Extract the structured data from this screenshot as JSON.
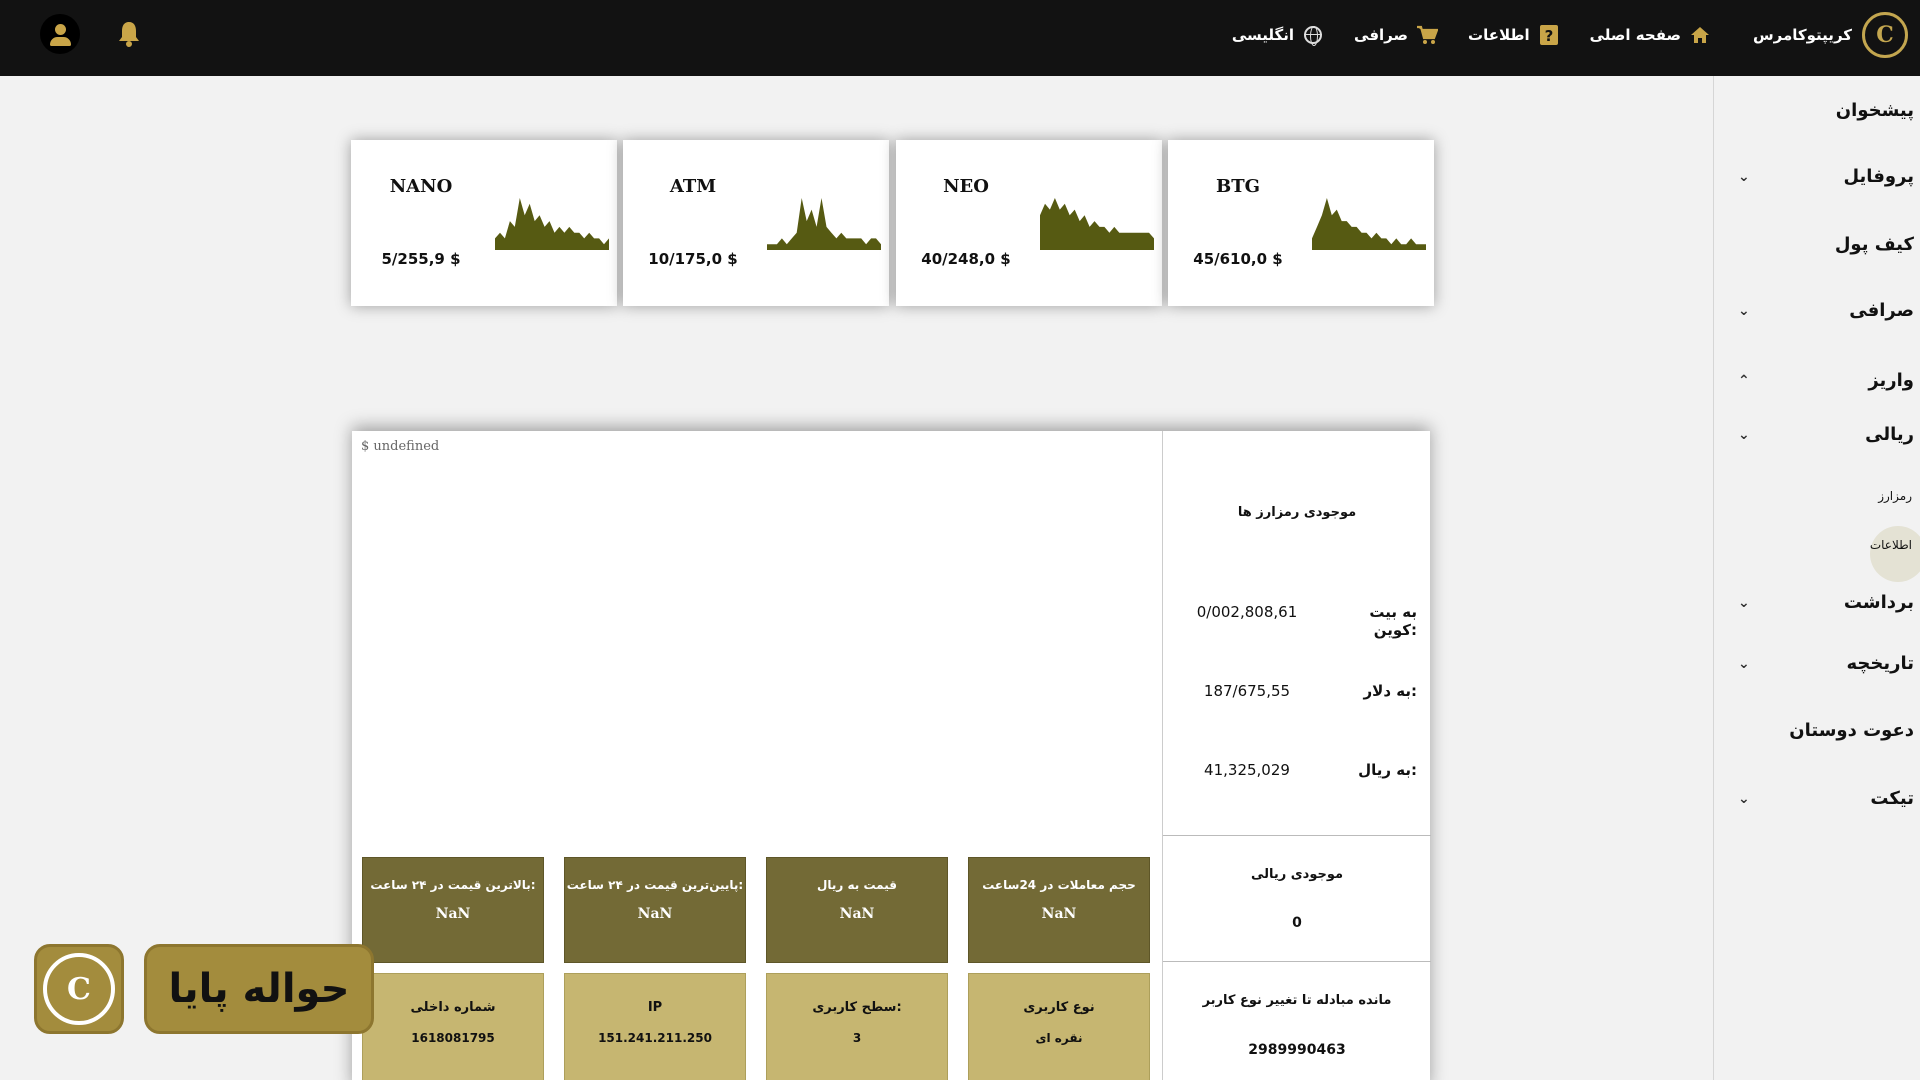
{
  "header": {
    "brand": "کریپتوکامرس",
    "nav": [
      {
        "label": "صفحه اصلی",
        "icon": "home-icon"
      },
      {
        "label": "اطلاعات",
        "icon": "help-icon"
      },
      {
        "label": "صرافی",
        "icon": "cart-icon"
      },
      {
        "label": "انگلیسی",
        "icon": "globe-icon"
      }
    ]
  },
  "sidebar": {
    "items": [
      {
        "label": "پیشخوان",
        "chevron": ""
      },
      {
        "label": "پروفایل",
        "chevron": "⌄"
      },
      {
        "label": "کیف پول",
        "chevron": ""
      },
      {
        "label": "صرافی",
        "chevron": "⌄"
      },
      {
        "label": "واریز",
        "chevron": "⌃"
      },
      {
        "label": "ریالی",
        "chevron": "⌄"
      },
      {
        "label": "برداشت",
        "chevron": "⌄"
      },
      {
        "label": "تاریخچه",
        "chevron": "⌄"
      },
      {
        "label": "دعوت دوستان",
        "chevron": ""
      },
      {
        "label": "تیکت",
        "chevron": "⌄"
      }
    ],
    "sub_items": [
      "رمزارز",
      "اطلاعات"
    ]
  },
  "cards": [
    {
      "name": "NANO",
      "price": "5/255,9 $",
      "spark": [
        2,
        3,
        2,
        5,
        4,
        9,
        6,
        8,
        5,
        6,
        4,
        5,
        3,
        4,
        3,
        4,
        3,
        3,
        2,
        3,
        2,
        2,
        1,
        2
      ]
    },
    {
      "name": "ATM",
      "price": "10/175,0 $",
      "spark": [
        1,
        1,
        1,
        2,
        1,
        2,
        3,
        9,
        5,
        7,
        4,
        9,
        4,
        3,
        2,
        3,
        2,
        2,
        2,
        2,
        1,
        2,
        2,
        1
      ]
    },
    {
      "name": "NEO",
      "price": "40/248,0 $",
      "spark": [
        6,
        8,
        7,
        9,
        7,
        8,
        6,
        7,
        5,
        6,
        4,
        5,
        4,
        4,
        3,
        4,
        3,
        3,
        3,
        3,
        3,
        3,
        3,
        2
      ]
    },
    {
      "name": "BTG",
      "price": "45/610,0 $",
      "spark": [
        2,
        4,
        6,
        9,
        6,
        7,
        5,
        5,
        4,
        4,
        3,
        3,
        2,
        3,
        2,
        2,
        1,
        2,
        1,
        1,
        2,
        1,
        1,
        1
      ]
    }
  ],
  "panel": {
    "chart_label": "$ undefined",
    "crypto_balance_title": "موجودی رمزارز ها",
    "rows": [
      {
        "label": "به بیت کوین:",
        "value": "0/002,808,61"
      },
      {
        "label": "به دلار:",
        "value": "187/675,55"
      },
      {
        "label": "به ریال:",
        "value": "41,325,029"
      }
    ],
    "rial_balance_title": "موجودی ریالی",
    "rial_balance_value": "0",
    "remaining_title": "مانده مبادله تا تغییر نوع کاربر",
    "remaining_value": "2989990463",
    "stats": [
      {
        "label": "حجم معاملات در 24ساعت",
        "value": "NaN"
      },
      {
        "label": "قیمت به ریال",
        "value": "NaN"
      },
      {
        "label": "پایین‌ترین قیمت در ۲۴ ساعت:",
        "value": "NaN"
      },
      {
        "label": "بالاترین قیمت در ۲۴ ساعت:",
        "value": "NaN"
      }
    ],
    "info": [
      {
        "label": "نوع کاربری",
        "value": "نقره ای"
      },
      {
        "label": "سطح کاربری:",
        "value": "3"
      },
      {
        "label": "IP",
        "value": "151.241.211.250"
      },
      {
        "label": "شماره داخلی",
        "value": "1618081795"
      }
    ]
  },
  "banner": {
    "text": "حواله پایا"
  },
  "colors": {
    "accent": "#c9a548",
    "spark": "#565a12",
    "stat_box": "#736a36",
    "info_box": "#c6b671"
  }
}
